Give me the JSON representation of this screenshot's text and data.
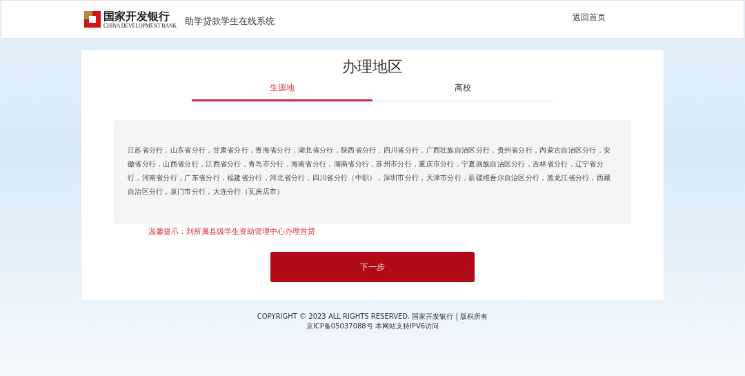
{
  "header": {
    "logo_name": "国家开发银行",
    "logo_subtitle": "CHINA DEVELOPMENT BANK",
    "system_title": "助学贷款学生在线系统",
    "home_link": "返回首页"
  },
  "page_title": "办理地区",
  "tabs": [
    {
      "label": "生源地",
      "selected": true
    },
    {
      "label": "高校",
      "selected": false
    }
  ],
  "branch_list": "江苏省分行，山东省分行，甘肃省分行，青海省分行，湖北省分行，陕西省分行，四川省分行，广西壮族自治区分行，贵州省分行，内蒙古自治区分行，安徽省分行，山西省分行，江西省分行，青岛市分行，海南省分行，湖南省分行，苏州市分行，重庆市分行，宁夏回族自治区分行，吉林省分行，辽宁省分行，河南省分行，广东省分行，福建省分行，河北省分行，四川省分行（中职），深圳市分行，天津市分行，新疆维吾尔自治区分行，黑龙江省分行，西藏自治区分行，厦门市分行，大连分行（瓦房店市）",
  "tip": "温馨提示：到所属县级学生资助管理中心办理首贷",
  "next_button": "下一步",
  "footer": [
    "COPYRIGHT © 2023 ALL RIGHTS RESERVED. 国家开发银行 | 版权所有",
    "京ICP备05037088号 本网站支持IPV6访问"
  ]
}
